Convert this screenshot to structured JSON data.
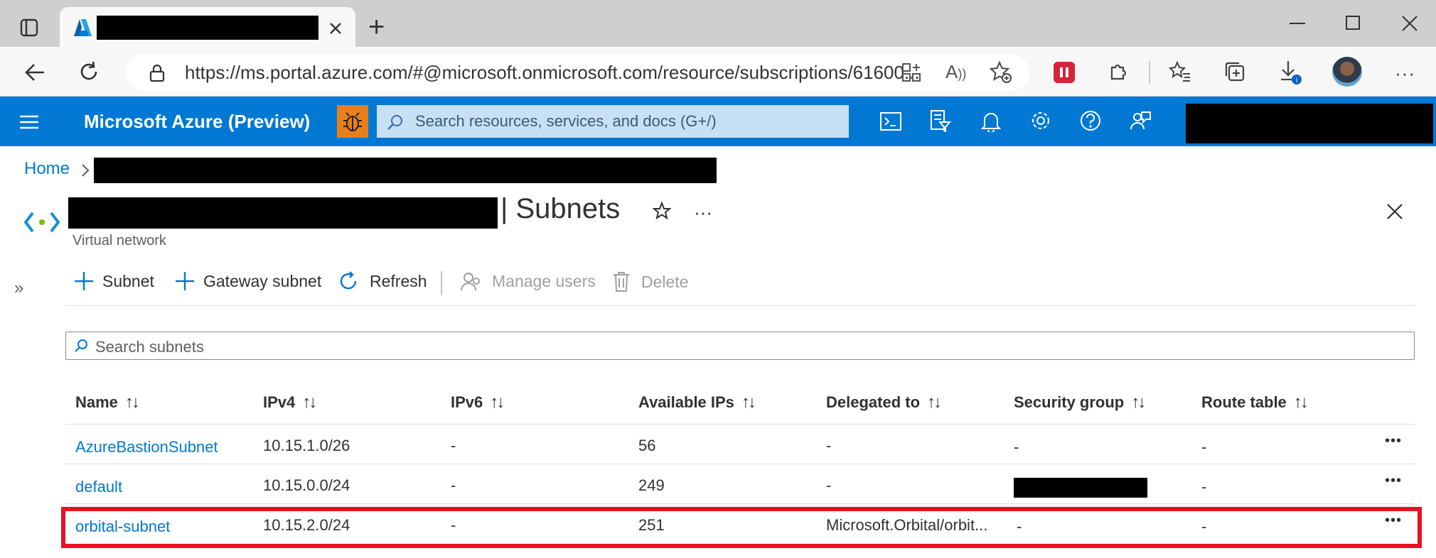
{
  "browser": {
    "address": "https://ms.portal.azure.com/#@microsoft.onmicrosoft.com/resource/subscriptions/61600...",
    "new_tab_symbol": "+"
  },
  "portal": {
    "title": "Microsoft Azure (Preview)",
    "search_placeholder": "Search resources, services, and docs (G+/)"
  },
  "breadcrumb": {
    "home": "Home"
  },
  "blade": {
    "title_suffix": "| Subnets",
    "subtitle": "Virtual network",
    "more": "···"
  },
  "toolbar": {
    "subnet": "Subnet",
    "gateway_subnet": "Gateway subnet",
    "refresh": "Refresh",
    "manage_users": "Manage users",
    "delete": "Delete"
  },
  "search": {
    "placeholder": "Search subnets"
  },
  "table": {
    "columns": [
      "Name",
      "IPv4",
      "IPv6",
      "Available IPs",
      "Delegated to",
      "Security group",
      "Route table"
    ],
    "rows": [
      {
        "name": "AzureBastionSubnet",
        "ipv4": "10.15.1.0/26",
        "ipv6": "-",
        "available": "56",
        "delegated": "-",
        "security": "-",
        "route": "-"
      },
      {
        "name": "default",
        "ipv4": "10.15.0.0/24",
        "ipv6": "-",
        "available": "249",
        "delegated": "-",
        "security": "",
        "route": "-"
      },
      {
        "name": "orbital-subnet",
        "ipv4": "10.15.2.0/24",
        "ipv6": "-",
        "available": "251",
        "delegated": "Microsoft.Orbital/orbit...",
        "security": "-",
        "route": "-"
      }
    ],
    "sort_symbol": "↑↓",
    "row_more": "•••"
  },
  "colors": {
    "azure_blue": "#0078d4",
    "highlight_red": "#e81123",
    "bug_orange": "#e8801a"
  }
}
